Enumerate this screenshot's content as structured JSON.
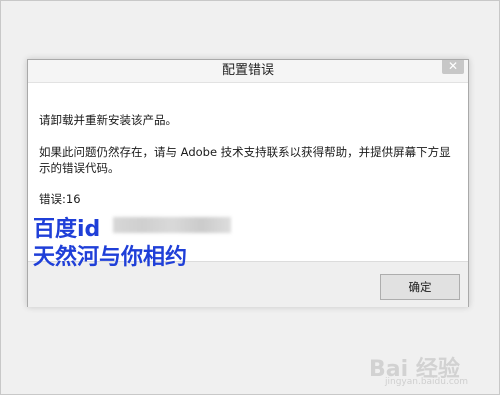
{
  "dialog": {
    "title": "配置错误",
    "close_glyph": "✕",
    "message_line1": "请卸载并重新安装该产品。",
    "message_line2": "如果此问题仍然存在，请与 Adobe 技术支持联系以获得帮助，并提供屏幕下方显",
    "message_line3": "示的错误代码。",
    "error_code": "错误:16",
    "ok_label": "确定"
  },
  "overlay": {
    "line1": "百度id",
    "line2": "天然河与你相约",
    "color": "#1f3fd8"
  },
  "watermark": {
    "main": "Bai 经验",
    "sub": "jingyan.baidu.com"
  }
}
